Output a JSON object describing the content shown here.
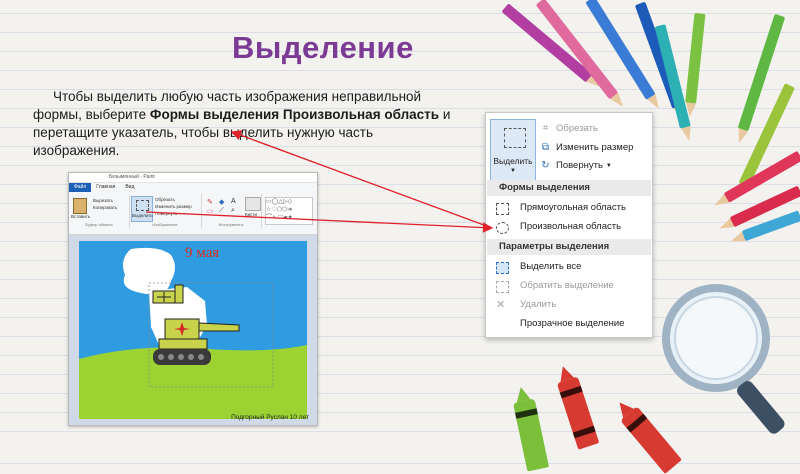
{
  "slide": {
    "title": "Выделение",
    "para_1": "Чтобы выделить любую часть изображения неправильной формы, выберите ",
    "para_bold": "Формы выделения Произвольная область",
    "para_2": " и перетащите указатель, чтобы выделить нужную часть изображения."
  },
  "paint": {
    "window_title": "Безымянный - Paint",
    "tabs": [
      "Файл",
      "Главная",
      "Вид"
    ],
    "ribbon": {
      "paste": "Вставить",
      "cut": "Вырезать",
      "copy": "Копировать",
      "select": "Выделить",
      "crop": "Обрезать",
      "resize": "Изменить размер",
      "rotate": "Повернуть",
      "brushes": "Кисти",
      "groups": [
        "Буфер обмена",
        "Изображение",
        "Инструменты"
      ]
    },
    "canvas_heading": "9 мая",
    "caption": "Подгорный Руслан 10 лет"
  },
  "menu": {
    "select_button": "Выделить",
    "tools": {
      "crop": "Обрезать",
      "resize": "Изменить размер",
      "rotate": "Повернуть"
    },
    "section_shapes": "Формы выделения",
    "shapes": [
      "Прямоугольная область",
      "Произвольная область"
    ],
    "section_options": "Параметры выделения",
    "options": [
      "Выделить все",
      "Обратить выделение",
      "Удалить",
      "Прозрачное выделение"
    ]
  },
  "colors": {
    "title": "#7b3a94",
    "arrow": "#e0202a",
    "menu_section": "#eaeaea",
    "select_button_bg": "#dde9f6"
  }
}
